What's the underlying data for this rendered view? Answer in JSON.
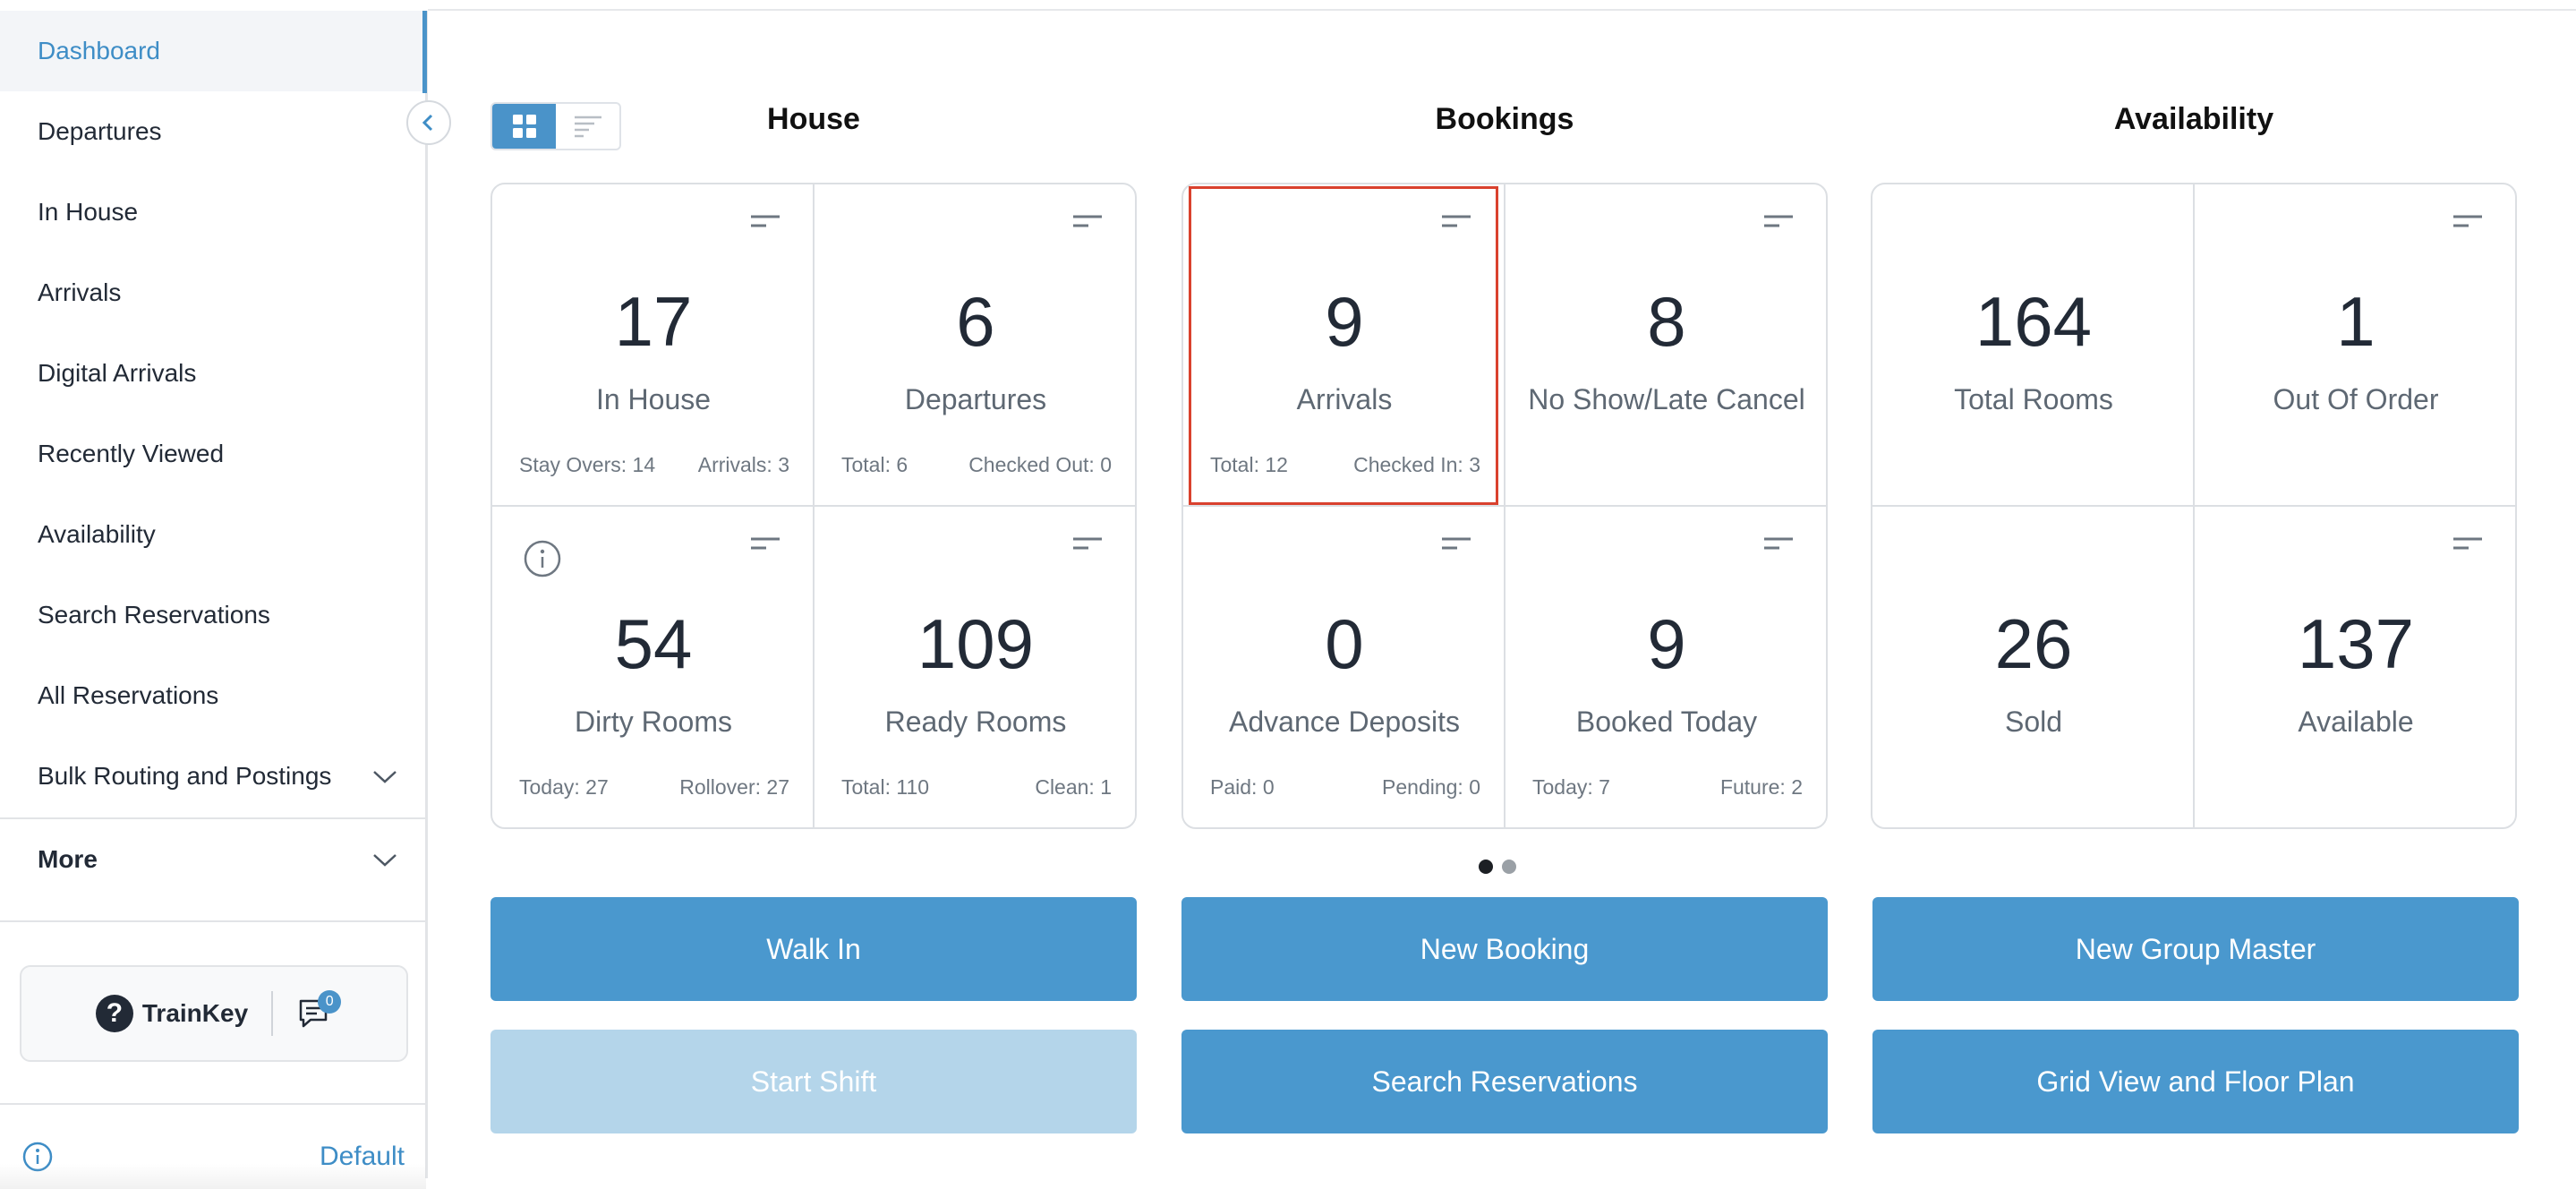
{
  "sidebar": {
    "items": [
      {
        "label": "Dashboard"
      },
      {
        "label": "Departures"
      },
      {
        "label": "In House"
      },
      {
        "label": "Arrivals"
      },
      {
        "label": "Digital Arrivals"
      },
      {
        "label": "Recently Viewed"
      },
      {
        "label": "Availability"
      },
      {
        "label": "Search Reservations"
      },
      {
        "label": "All Reservations"
      },
      {
        "label": "Bulk Routing and Postings"
      },
      {
        "label": "More"
      }
    ],
    "trainkey_label": "TrainKey",
    "messages_count": "0",
    "profile_label": "Default"
  },
  "sections": {
    "house": "House",
    "bookings": "Bookings",
    "availability": "Availability"
  },
  "tiles": {
    "in_house": {
      "value": "17",
      "label": "In House",
      "sub_left": "Stay Overs: 14",
      "sub_right": "Arrivals: 3"
    },
    "departures": {
      "value": "6",
      "label": "Departures",
      "sub_left": "Total: 6",
      "sub_right": "Checked Out: 0"
    },
    "dirty_rooms": {
      "value": "54",
      "label": "Dirty Rooms",
      "sub_left": "Today: 27",
      "sub_right": "Rollover: 27"
    },
    "ready_rooms": {
      "value": "109",
      "label": "Ready Rooms",
      "sub_left": "Total: 110",
      "sub_right": "Clean: 1"
    },
    "arrivals": {
      "value": "9",
      "label": "Arrivals",
      "sub_left": "Total: 12",
      "sub_right": "Checked In: 3"
    },
    "no_show": {
      "value": "8",
      "label": "No Show/Late Cancel"
    },
    "advance_deposits": {
      "value": "0",
      "label": "Advance Deposits",
      "sub_left": "Paid: 0",
      "sub_right": "Pending: 0"
    },
    "booked_today": {
      "value": "9",
      "label": "Booked Today",
      "sub_left": "Today: 7",
      "sub_right": "Future: 2"
    },
    "total_rooms": {
      "value": "164",
      "label": "Total Rooms"
    },
    "out_of_order": {
      "value": "1",
      "label": "Out Of Order"
    },
    "sold": {
      "value": "26",
      "label": "Sold"
    },
    "available": {
      "value": "137",
      "label": "Available"
    }
  },
  "actions": {
    "walk_in": "Walk In",
    "new_booking": "New Booking",
    "new_group_master": "New Group Master",
    "start_shift": "Start Shift",
    "search_reservations": "Search Reservations",
    "grid_view": "Grid View and Floor Plan"
  },
  "colors": {
    "accent": "#4a98ce",
    "highlight": "#d9412e",
    "active_nav": "#3e8dc6"
  },
  "icons": {
    "collapse": "chevron-left-icon",
    "tile_menu": "sort-lines-icon",
    "info": "info-icon",
    "help": "question-circle-icon",
    "messages": "chat-bubble-icon"
  }
}
